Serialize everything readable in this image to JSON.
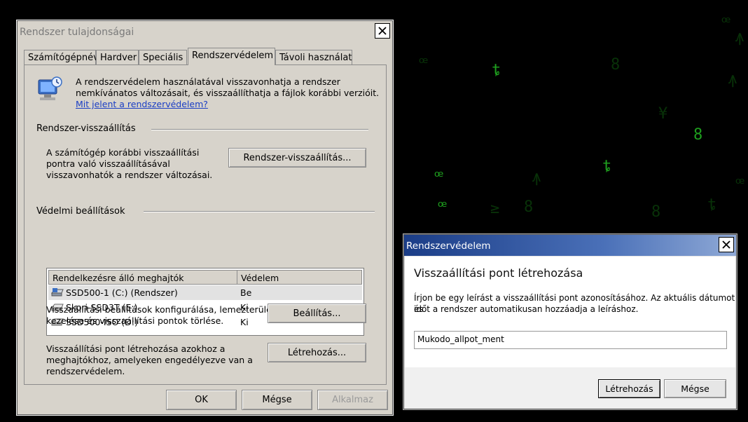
{
  "background": {
    "glyphs": [
      "ꟹ",
      "ȶ",
      "8",
      "ꟹ",
      "ꙟ",
      "ȶ",
      "¥",
      "8",
      "ꟹ",
      "ꙟ",
      "ȶ",
      "≥",
      "8",
      "ꟹ",
      "ꙟ",
      "ꟹ",
      "8"
    ]
  },
  "window1": {
    "title": "Rendszer tulajdonságai",
    "tabs": [
      "Számítógépnév",
      "Hardver",
      "Speciális",
      "Rendszervédelem",
      "Távoli használat"
    ],
    "active_tab": "Rendszervédelem",
    "intro_line1": "A rendszervédelem használatával visszavonhatja a rendszer",
    "intro_line2": "nemkívánatos változásait, és visszaállíthatja a fájlok korábbi verzióit.",
    "intro_link": "Mit jelent a rendszervédelem?",
    "restore_section": {
      "label": "Rendszer-visszaállítás",
      "desc_line1": "A számítógép korábbi visszaállítási",
      "desc_line2": "pontra való visszaállításával",
      "desc_line3": "visszavonhatók a rendszer változásai.",
      "button": "Rendszer-visszaállítás..."
    },
    "protection_section": {
      "label": "Védelmi beállítások",
      "columns": [
        "Rendelkezésre álló meghajtók",
        "Védelem"
      ],
      "rows": [
        {
          "drive": "SSD500-1 (C:) (Rendszer)",
          "protection": "Be",
          "icon": "system-drive-icon"
        },
        {
          "drive": "Skori-SSD3T (E:)",
          "protection": "Ki",
          "icon": "drive-icon"
        },
        {
          "drive": "SSD500-ISO (D:)",
          "protection": "Ki",
          "icon": "drive-icon"
        }
      ],
      "configure_line1": "Visszaállítási beállítások konfigurálása, lemezterület",
      "configure_line2": "kezelése és visszaállítási pontok törlése.",
      "configure_button": "Beállítás...",
      "create_line1": "Visszaállítási pont létrehozása azokhoz a",
      "create_line2": "meghajtókhoz, amelyeken engedélyezve van a",
      "create_line3": "rendszervédelem.",
      "create_button": "Létrehozás..."
    },
    "footer": {
      "ok": "OK",
      "cancel": "Mégse",
      "apply": "Alkalmaz"
    }
  },
  "window2": {
    "title": "Rendszervédelem",
    "heading": "Visszaállítási pont létrehozása",
    "desc_line1": "Írjon be egy leírást a visszaállítási pont azonosításához. Az aktuális dátumot és",
    "desc_line2": "időt a rendszer automatikusan hozzáadja a leíráshoz.",
    "input_value": "Mukodo_allpot_ment",
    "create_button": "Létrehozás",
    "cancel_button": "Mégse"
  }
}
